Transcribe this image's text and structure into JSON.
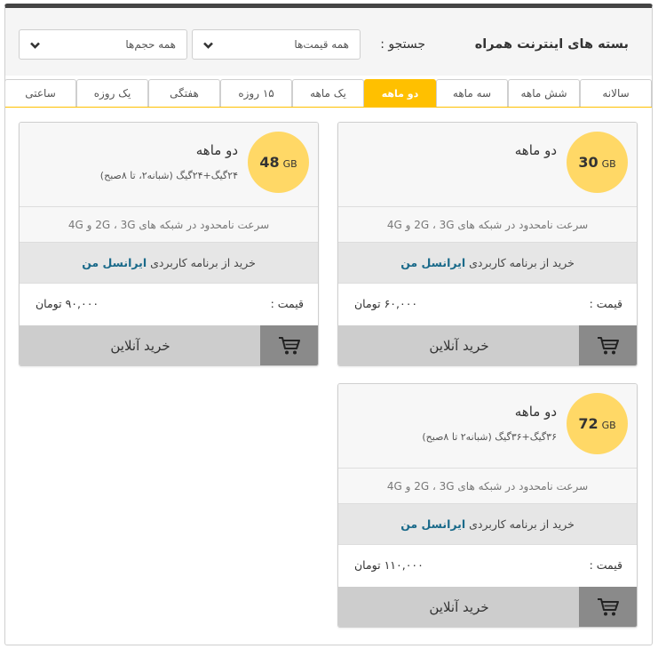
{
  "header": {
    "title": "بسته های اینترنت همراه",
    "search_label": "جستجو :",
    "price_select": {
      "value": "همه قیمت‌ها"
    },
    "size_select": {
      "value": "همه حجم‌ها"
    }
  },
  "tabs": [
    {
      "label": "سالانه",
      "active": false
    },
    {
      "label": "شش ماهه",
      "active": false
    },
    {
      "label": "سه ماهه",
      "active": false
    },
    {
      "label": "دو ماهه",
      "active": true
    },
    {
      "label": "یک ماهه",
      "active": false
    },
    {
      "label": "۱۵ روزه",
      "active": false
    },
    {
      "label": "هفتگی",
      "active": false
    },
    {
      "label": "یک روزه",
      "active": false
    },
    {
      "label": "ساعتی",
      "active": false
    }
  ],
  "cards": [
    {
      "volume": "30",
      "unit": "GB",
      "title": "دو ماهه",
      "subtitle": "",
      "speed": "سرعت نامحدود در شبکه های 2G ، 3G و 4G",
      "app_prefix": "خرید از برنامه کاربردی",
      "app_name": "ایرانسل من",
      "price_label": "قیمت :",
      "price": "۶۰,۰۰۰ تومان",
      "buy_label": "خرید آنلاین"
    },
    {
      "volume": "48",
      "unit": "GB",
      "title": "دو ماهه",
      "subtitle": "۲۴گیگ+۲۴گیگ (شبانه۲، تا ۸صبح)",
      "speed": "سرعت نامحدود در شبکه های 2G ، 3G و 4G",
      "app_prefix": "خرید از برنامه کاربردی",
      "app_name": "ایرانسل من",
      "price_label": "قیمت :",
      "price": "۹۰,۰۰۰ تومان",
      "buy_label": "خرید آنلاین"
    },
    {
      "volume": "72",
      "unit": "GB",
      "title": "دو ماهه",
      "subtitle": "۳۶گیگ+۳۶گیگ (شبانه۲ تا ۸صبح)",
      "speed": "سرعت نامحدود در شبکه های 2G ، 3G و 4G",
      "app_prefix": "خرید از برنامه کاربردی",
      "app_name": "ایرانسل من",
      "price_label": "قیمت :",
      "price": "۱۱۰,۰۰۰ تومان",
      "buy_label": "خرید آنلاین"
    }
  ],
  "colors": {
    "accent": "#ffc000",
    "badge": "#ffd866",
    "link": "#1a6a8a"
  }
}
